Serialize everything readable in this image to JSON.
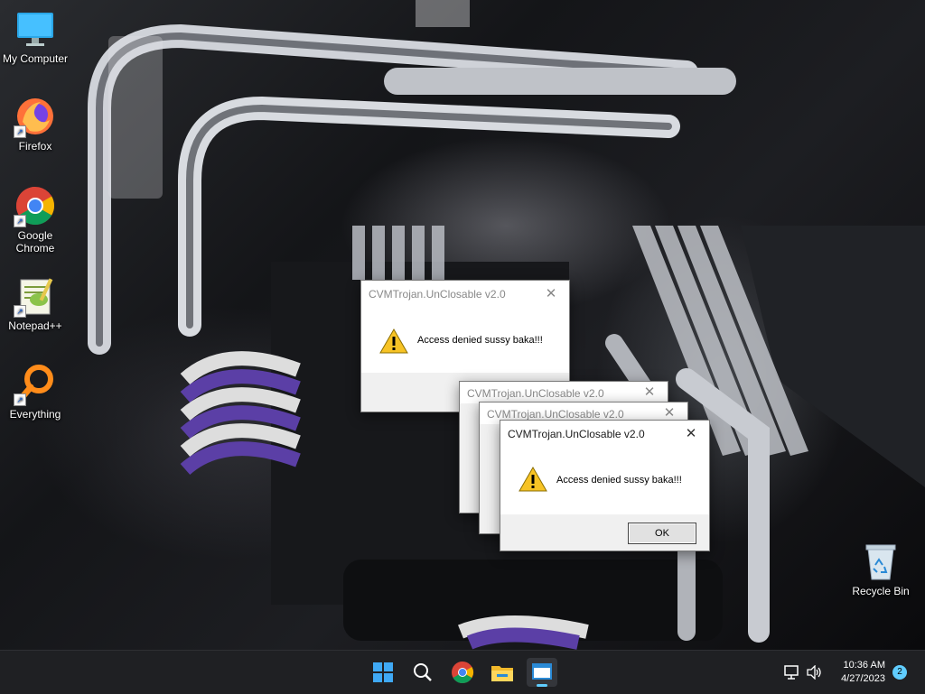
{
  "desktop": {
    "icons": [
      {
        "label": "My Computer",
        "icon": "monitor-icon"
      },
      {
        "label": "Firefox",
        "icon": "firefox-icon"
      },
      {
        "label": "Google\nChrome",
        "icon": "chrome-icon"
      },
      {
        "label": "Notepad++",
        "icon": "notepadpp-icon"
      },
      {
        "label": "Everything",
        "icon": "everything-search-icon"
      },
      {
        "label": "Recycle Bin",
        "icon": "recycle-bin-icon"
      }
    ]
  },
  "dialogs": [
    {
      "title": "CVMTrojan.UnClosable v2.0",
      "message": "Access denied sussy baka!!!",
      "state": "inactive"
    },
    {
      "title": "CVMTrojan.UnClosable v2.0",
      "message": "",
      "state": "inactive"
    },
    {
      "title": "CVMTrojan.UnClosable v2.0",
      "message": "",
      "state": "inactive"
    },
    {
      "title": "CVMTrojan.UnClosable v2.0",
      "message": "Access denied sussy baka!!!",
      "ok_label": "OK",
      "state": "active"
    }
  ],
  "taskbar": {
    "apps": [
      "start-icon",
      "search-icon",
      "chrome-icon",
      "file-explorer-icon",
      "trojan-app-icon"
    ],
    "time": "10:36 AM",
    "date": "4/27/2023",
    "notification_count": "2",
    "accent": "#60cdff"
  }
}
